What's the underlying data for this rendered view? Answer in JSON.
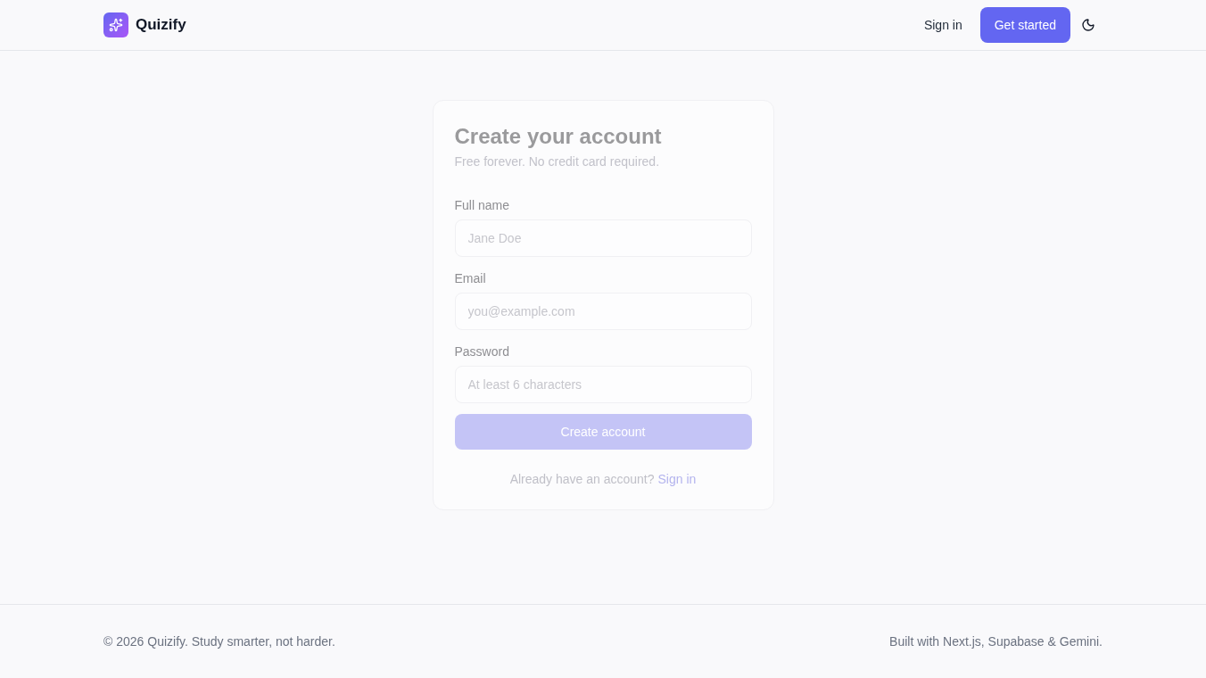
{
  "header": {
    "brand": "Quizify",
    "nav": [
      {
        "label": "Sign in",
        "kind": "link"
      },
      {
        "label": "Get started",
        "kind": "primary"
      }
    ]
  },
  "form": {
    "title": "Create your account",
    "subtitle": "Free forever. No credit card required.",
    "fields": [
      {
        "label": "Full name",
        "placeholder": "Jane Doe"
      },
      {
        "label": "Email",
        "placeholder": "you@example.com"
      },
      {
        "label": "Password",
        "placeholder": "At least 6 characters"
      }
    ],
    "submit": "Create account",
    "prompt": {
      "text": "Already have an account?",
      "link": "Sign in"
    }
  },
  "footer": {
    "left": "© 2026 Quizify. Study smarter, not harder.",
    "right": "Built with Next.js, Supabase & Gemini."
  }
}
